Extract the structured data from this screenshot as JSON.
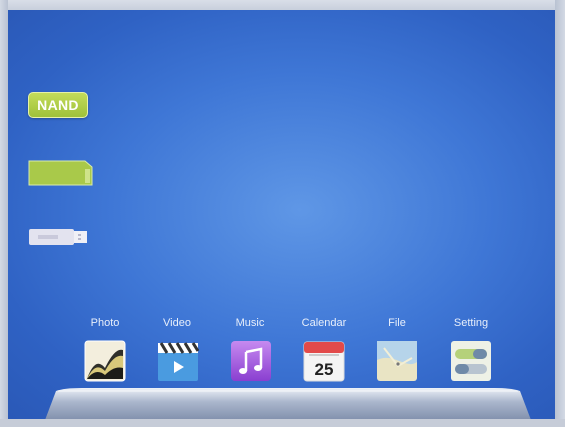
{
  "sources": {
    "nand_label": "NAND",
    "sd_card_icon": "sd-card-icon",
    "usb_icon": "usb-drive-icon"
  },
  "dock": {
    "apps": [
      {
        "label": "Photo",
        "icon": "photo-icon"
      },
      {
        "label": "Video",
        "icon": "video-icon"
      },
      {
        "label": "Music",
        "icon": "music-icon"
      },
      {
        "label": "Calendar",
        "icon": "calendar-icon",
        "day": "25"
      },
      {
        "label": "File",
        "icon": "file-icon"
      },
      {
        "label": "Setting",
        "icon": "settings-icon"
      }
    ]
  },
  "colors": {
    "background": "#3f77d6",
    "nand_badge": "#a8c844",
    "label_text": "#e8effb"
  }
}
